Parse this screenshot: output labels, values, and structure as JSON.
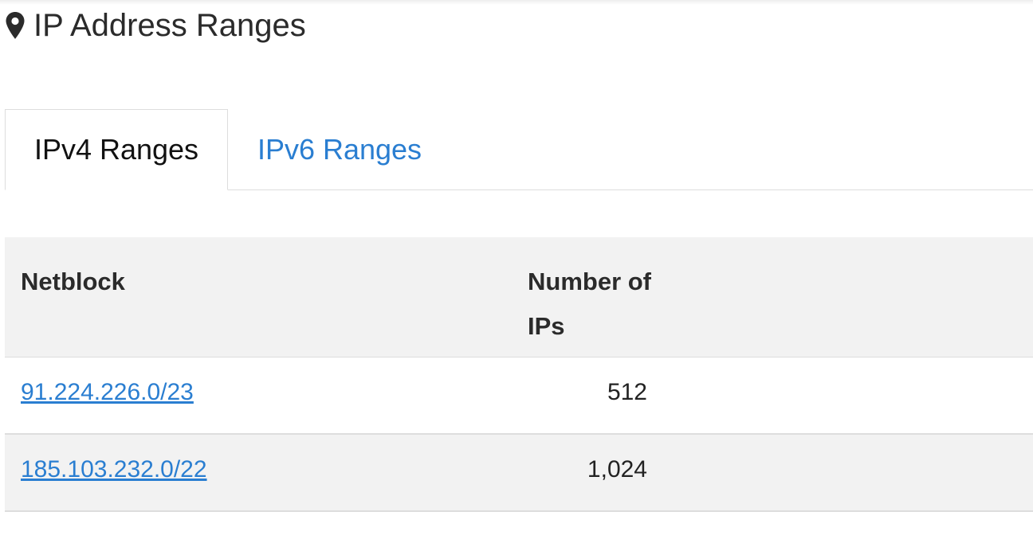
{
  "header": {
    "title": "IP Address Ranges",
    "icon": "map-pin-icon"
  },
  "tabs": [
    {
      "label": "IPv4 Ranges",
      "active": true
    },
    {
      "label": "IPv6 Ranges",
      "active": false
    }
  ],
  "colors": {
    "link": "#2a7ed1",
    "header_bg": "#f2f2f2",
    "border": "#dddddd"
  },
  "table": {
    "columns": [
      "Netblock",
      "Number of IPs"
    ],
    "rows": [
      {
        "netblock": "91.224.226.0/23",
        "count": "512"
      },
      {
        "netblock": "185.103.232.0/22",
        "count": "1,024"
      }
    ]
  }
}
